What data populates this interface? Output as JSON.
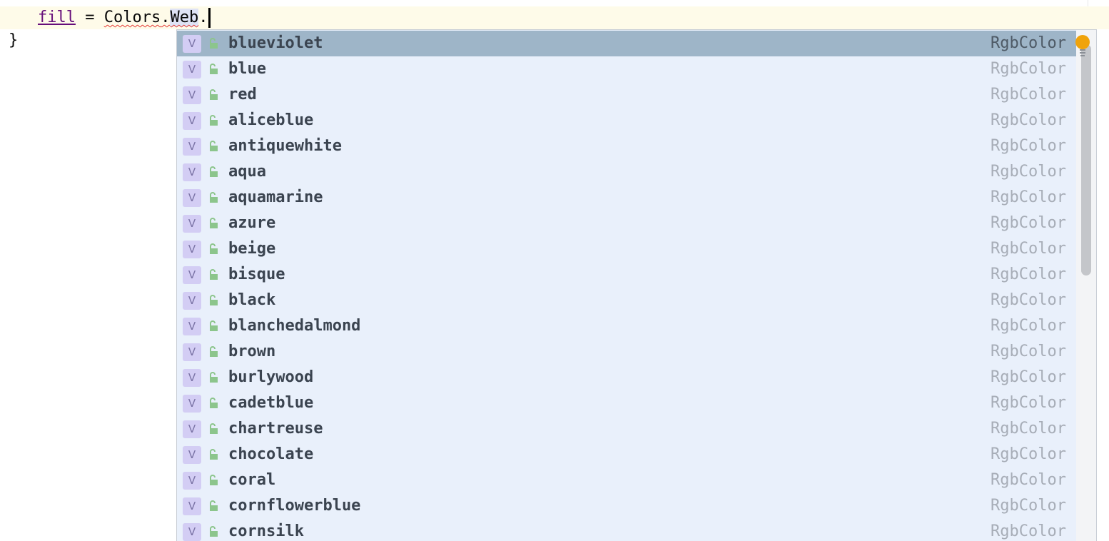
{
  "editor": {
    "code": {
      "indent": "    ",
      "var_name": "fill",
      "equals": " = ",
      "receiver": "Colors",
      "dot1": ".",
      "member": "Web",
      "dot2": ".",
      "closing_brace": "}"
    }
  },
  "completion": {
    "items": [
      {
        "kind": "V",
        "name": "blueviolet",
        "type": "RgbColor"
      },
      {
        "kind": "V",
        "name": "blue",
        "type": "RgbColor"
      },
      {
        "kind": "V",
        "name": "red",
        "type": "RgbColor"
      },
      {
        "kind": "V",
        "name": "aliceblue",
        "type": "RgbColor"
      },
      {
        "kind": "V",
        "name": "antiquewhite",
        "type": "RgbColor"
      },
      {
        "kind": "V",
        "name": "aqua",
        "type": "RgbColor"
      },
      {
        "kind": "V",
        "name": "aquamarine",
        "type": "RgbColor"
      },
      {
        "kind": "V",
        "name": "azure",
        "type": "RgbColor"
      },
      {
        "kind": "V",
        "name": "beige",
        "type": "RgbColor"
      },
      {
        "kind": "V",
        "name": "bisque",
        "type": "RgbColor"
      },
      {
        "kind": "V",
        "name": "black",
        "type": "RgbColor"
      },
      {
        "kind": "V",
        "name": "blanchedalmond",
        "type": "RgbColor"
      },
      {
        "kind": "V",
        "name": "brown",
        "type": "RgbColor"
      },
      {
        "kind": "V",
        "name": "burlywood",
        "type": "RgbColor"
      },
      {
        "kind": "V",
        "name": "cadetblue",
        "type": "RgbColor"
      },
      {
        "kind": "V",
        "name": "chartreuse",
        "type": "RgbColor"
      },
      {
        "kind": "V",
        "name": "chocolate",
        "type": "RgbColor"
      },
      {
        "kind": "V",
        "name": "coral",
        "type": "RgbColor"
      },
      {
        "kind": "V",
        "name": "cornflowerblue",
        "type": "RgbColor"
      },
      {
        "kind": "V",
        "name": "cornsilk",
        "type": "RgbColor"
      }
    ],
    "selected_index": 0,
    "icons": {
      "kind": "variable-icon",
      "visibility": "public-lock-icon",
      "action": "intention-bulb-icon"
    },
    "colors": {
      "popup_bg": "#e9f0fb",
      "selected_bg": "#9eb5c8",
      "badge_bg": "#d3cdf4",
      "lock": "#8cc58c",
      "bulb": "#f0a30a"
    }
  }
}
